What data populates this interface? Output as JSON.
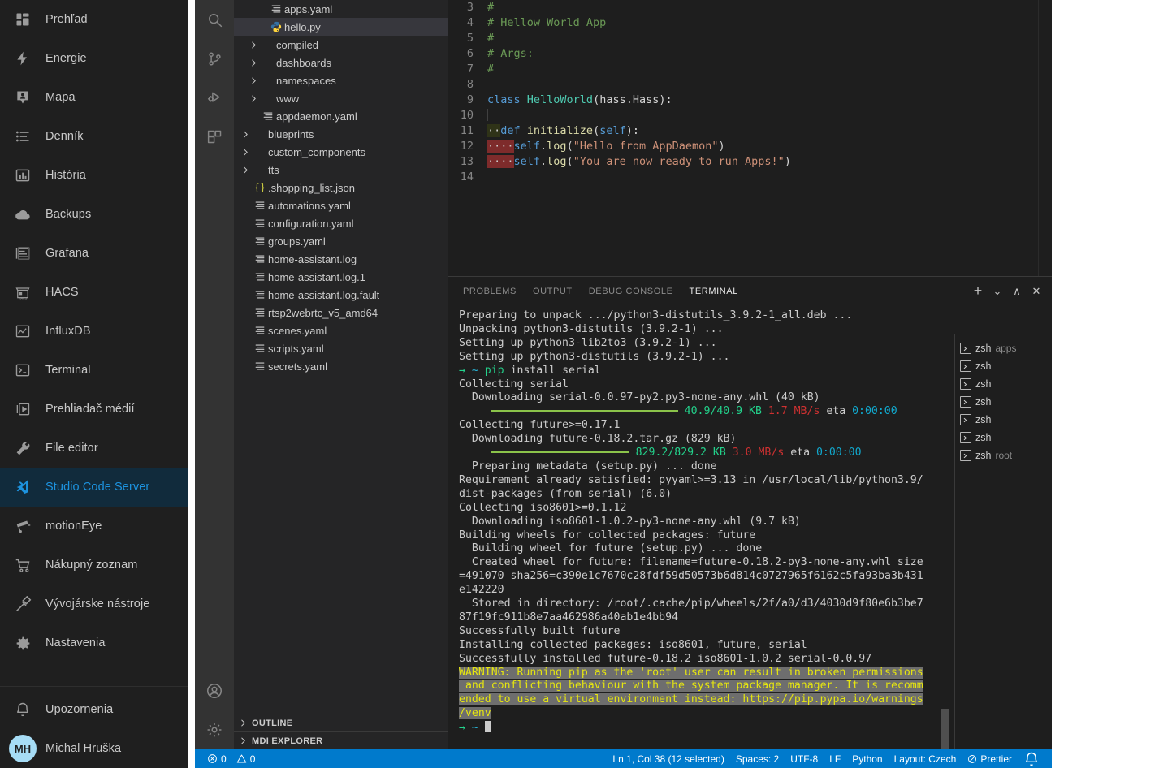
{
  "ha_sidebar": {
    "items": [
      {
        "label": "Prehľad",
        "icon": "dashboard-icon",
        "active": false
      },
      {
        "label": "Energie",
        "icon": "lightning-icon",
        "active": false
      },
      {
        "label": "Mapa",
        "icon": "map-marker-icon",
        "active": false
      },
      {
        "label": "Denník",
        "icon": "logbook-icon",
        "active": false
      },
      {
        "label": "História",
        "icon": "chart-bar-icon",
        "active": false
      },
      {
        "label": "Backups",
        "icon": "cloud-icon",
        "active": false
      },
      {
        "label": "Grafana",
        "icon": "grafana-icon",
        "active": false
      },
      {
        "label": "HACS",
        "icon": "hacs-store-icon",
        "active": false
      },
      {
        "label": "InfluxDB",
        "icon": "influxdb-chart-icon",
        "active": false
      },
      {
        "label": "Terminal",
        "icon": "terminal-icon",
        "active": false
      },
      {
        "label": "Prehliadač médií",
        "icon": "media-player-icon",
        "active": false
      },
      {
        "label": "File editor",
        "icon": "wrench-icon",
        "active": false
      },
      {
        "label": "Studio Code Server",
        "icon": "vscode-icon",
        "active": true
      },
      {
        "label": "motionEye",
        "icon": "cctv-camera-icon",
        "active": false
      },
      {
        "label": "Nákupný zoznam",
        "icon": "shopping-cart-icon",
        "active": false
      },
      {
        "label": "Vývojárske nástroje",
        "icon": "hammer-icon",
        "active": false
      },
      {
        "label": "Nastavenia",
        "icon": "gear-icon",
        "active": false
      }
    ],
    "footer": [
      {
        "label": "Upozornenia",
        "icon": "bell-icon"
      },
      {
        "label": "Michal Hruška",
        "icon": "avatar",
        "initials": "MH"
      }
    ],
    "accent_color": "#1d93df",
    "active_bg": "#112b3c"
  },
  "activity_bar": {
    "icons": [
      {
        "name": "search-icon"
      },
      {
        "name": "source-control-icon"
      },
      {
        "name": "run-and-debug-icon"
      },
      {
        "name": "extensions-icon"
      }
    ],
    "bottom_icons": [
      {
        "name": "accounts-icon"
      },
      {
        "name": "manage-gear-icon"
      }
    ]
  },
  "explorer": {
    "rows": [
      {
        "indent": 3,
        "twist": "",
        "icon": "yaml-icon",
        "name": "apps.yaml",
        "selected": false
      },
      {
        "indent": 3,
        "twist": "",
        "icon": "python-icon",
        "name": "hello.py",
        "selected": true
      },
      {
        "indent": 2,
        "twist": "chevron-right-icon",
        "icon": "",
        "name": "compiled",
        "selected": false
      },
      {
        "indent": 2,
        "twist": "chevron-right-icon",
        "icon": "",
        "name": "dashboards",
        "selected": false
      },
      {
        "indent": 2,
        "twist": "chevron-right-icon",
        "icon": "",
        "name": "namespaces",
        "selected": false
      },
      {
        "indent": 2,
        "twist": "chevron-right-icon",
        "icon": "",
        "name": "www",
        "selected": false
      },
      {
        "indent": 2,
        "twist": "",
        "icon": "yaml-icon",
        "name": "appdaemon.yaml",
        "selected": false
      },
      {
        "indent": 1,
        "twist": "chevron-right-icon",
        "icon": "",
        "name": "blueprints",
        "selected": false
      },
      {
        "indent": 1,
        "twist": "chevron-right-icon",
        "icon": "",
        "name": "custom_components",
        "selected": false
      },
      {
        "indent": 1,
        "twist": "chevron-right-icon",
        "icon": "",
        "name": "tts",
        "selected": false
      },
      {
        "indent": 1,
        "twist": "",
        "icon": "json-icon",
        "name": ".shopping_list.json",
        "selected": false
      },
      {
        "indent": 1,
        "twist": "",
        "icon": "yaml-icon",
        "name": "automations.yaml",
        "selected": false
      },
      {
        "indent": 1,
        "twist": "",
        "icon": "yaml-icon",
        "name": "configuration.yaml",
        "selected": false
      },
      {
        "indent": 1,
        "twist": "",
        "icon": "yaml-icon",
        "name": "groups.yaml",
        "selected": false
      },
      {
        "indent": 1,
        "twist": "",
        "icon": "yaml-icon",
        "name": "home-assistant.log",
        "selected": false
      },
      {
        "indent": 1,
        "twist": "",
        "icon": "yaml-icon",
        "name": "home-assistant.log.1",
        "selected": false
      },
      {
        "indent": 1,
        "twist": "",
        "icon": "yaml-icon",
        "name": "home-assistant.log.fault",
        "selected": false
      },
      {
        "indent": 1,
        "twist": "",
        "icon": "yaml-icon",
        "name": "rtsp2webrtc_v5_amd64",
        "selected": false
      },
      {
        "indent": 1,
        "twist": "",
        "icon": "yaml-icon",
        "name": "scenes.yaml",
        "selected": false
      },
      {
        "indent": 1,
        "twist": "",
        "icon": "yaml-icon",
        "name": "scripts.yaml",
        "selected": false
      },
      {
        "indent": 1,
        "twist": "",
        "icon": "yaml-icon",
        "name": "secrets.yaml",
        "selected": false
      }
    ],
    "sections": [
      {
        "label": "OUTLINE"
      },
      {
        "label": "MDI EXPLORER"
      }
    ]
  },
  "editor": {
    "lines": [
      {
        "num": "3",
        "segments": [
          {
            "t": "#",
            "c": "c-comment",
            "pad": 0
          }
        ]
      },
      {
        "num": "4",
        "segments": [
          {
            "t": "# Hellow World App",
            "c": "c-comment",
            "pad": 0
          }
        ]
      },
      {
        "num": "5",
        "segments": [
          {
            "t": "#",
            "c": "c-comment",
            "pad": 0
          }
        ]
      },
      {
        "num": "6",
        "segments": [
          {
            "t": "# Args:",
            "c": "c-comment",
            "pad": 0
          }
        ]
      },
      {
        "num": "7",
        "segments": [
          {
            "t": "#",
            "c": "c-comment",
            "pad": 0
          }
        ]
      },
      {
        "num": "8",
        "segments": []
      },
      {
        "num": "9",
        "segments": [
          {
            "t": "class ",
            "c": "c-key"
          },
          {
            "t": "HelloWorld",
            "c": "c-class"
          },
          {
            "t": "(hass.Hass):",
            "c": "c-plain"
          }
        ]
      },
      {
        "num": "10",
        "segments": []
      },
      {
        "num": "11",
        "segments": [
          {
            "t": "··",
            "c": "ws-ok"
          },
          {
            "t": "def ",
            "c": "c-key"
          },
          {
            "t": "initialize",
            "c": "c-fn"
          },
          {
            "t": "(",
            "c": "c-plain"
          },
          {
            "t": "self",
            "c": "c-key"
          },
          {
            "t": "):",
            "c": "c-plain"
          }
        ]
      },
      {
        "num": "12",
        "segments": [
          {
            "t": "····",
            "c": "ws-err"
          },
          {
            "t": "self",
            "c": "c-key"
          },
          {
            "t": ".",
            "c": "c-plain"
          },
          {
            "t": "log",
            "c": "c-fn"
          },
          {
            "t": "(",
            "c": "c-plain"
          },
          {
            "t": "\"Hello from AppDaemon\"",
            "c": "c-str"
          },
          {
            "t": ")",
            "c": "c-plain"
          }
        ]
      },
      {
        "num": "13",
        "segments": [
          {
            "t": "····",
            "c": "ws-err"
          },
          {
            "t": "self",
            "c": "c-key"
          },
          {
            "t": ".",
            "c": "c-plain"
          },
          {
            "t": "log",
            "c": "c-fn"
          },
          {
            "t": "(",
            "c": "c-plain"
          },
          {
            "t": "\"You are now ready to run Apps!\"",
            "c": "c-str"
          },
          {
            "t": ")",
            "c": "c-plain"
          }
        ]
      },
      {
        "num": "14",
        "segments": []
      }
    ]
  },
  "panel": {
    "tabs": [
      {
        "label": "PROBLEMS",
        "active": false
      },
      {
        "label": "OUTPUT",
        "active": false
      },
      {
        "label": "DEBUG CONSOLE",
        "active": false
      },
      {
        "label": "TERMINAL",
        "active": true
      }
    ],
    "actions": [
      {
        "name": "new-terminal-icon",
        "glyph": "+"
      },
      {
        "name": "terminal-dropdown-icon",
        "glyph": "⌄"
      },
      {
        "name": "maximize-panel-icon",
        "glyph": "∧"
      },
      {
        "name": "close-panel-icon",
        "glyph": "✕"
      }
    ],
    "terminal_list": [
      {
        "label": "zsh",
        "sub": "apps"
      },
      {
        "label": "zsh",
        "sub": ""
      },
      {
        "label": "zsh",
        "sub": ""
      },
      {
        "label": "zsh",
        "sub": ""
      },
      {
        "label": "zsh",
        "sub": ""
      },
      {
        "label": "zsh",
        "sub": ""
      },
      {
        "label": "zsh",
        "sub": "root"
      }
    ],
    "terminal_lines": [
      [
        {
          "t": "Preparing to unpack .../python3-distutils_3.9.2-1_all.deb ..."
        }
      ],
      [
        {
          "t": "Unpacking python3-distutils (3.9.2-1) ..."
        }
      ],
      [
        {
          "t": "Setting up python3-lib2to3 (3.9.2-1) ..."
        }
      ],
      [
        {
          "t": "Setting up python3-distutils (3.9.2-1) ..."
        }
      ],
      [
        {
          "t": "→ ",
          "c": "t-arrow"
        },
        {
          "t": "~ ",
          "c": "t-tilde"
        },
        {
          "t": "pip",
          "c": "t-green"
        },
        {
          "t": " install serial"
        }
      ],
      [
        {
          "t": "Collecting serial"
        }
      ],
      [
        {
          "t": "  Downloading serial-0.0.97-py2.py3-none-any.whl (40 kB)"
        }
      ],
      [
        {
          "t": "     ",
          "bar": 1
        },
        {
          "t": " 40.9/40.9 KB",
          "c": "t-green"
        },
        {
          "t": " 1.7 MB/s",
          "c": "t-red"
        },
        {
          "t": " eta "
        },
        {
          "t": "0:00:00",
          "c": "t-blue"
        }
      ],
      [
        {
          "t": "Collecting future>=0.17.1"
        }
      ],
      [
        {
          "t": "  Downloading future-0.18.2.tar.gz (829 kB)"
        }
      ],
      [
        {
          "t": "     ",
          "bar": 2
        },
        {
          "t": " 829.2/829.2 KB",
          "c": "t-green"
        },
        {
          "t": " 3.0 MB/s",
          "c": "t-red"
        },
        {
          "t": " eta "
        },
        {
          "t": "0:00:00",
          "c": "t-blue"
        }
      ],
      [
        {
          "t": "  Preparing metadata (setup.py) ... done"
        }
      ],
      [
        {
          "t": "Requirement already satisfied: pyyaml>=3.13 in /usr/local/lib/python3.9/"
        }
      ],
      [
        {
          "t": "dist-packages (from serial) (6.0)"
        }
      ],
      [
        {
          "t": "Collecting iso8601>=0.1.12"
        }
      ],
      [
        {
          "t": "  Downloading iso8601-1.0.2-py3-none-any.whl (9.7 kB)"
        }
      ],
      [
        {
          "t": "Building wheels for collected packages: future"
        }
      ],
      [
        {
          "t": "  Building wheel for future (setup.py) ... done"
        }
      ],
      [
        {
          "t": "  Created wheel for future: filename=future-0.18.2-py3-none-any.whl size"
        }
      ],
      [
        {
          "t": "=491070 sha256=c390e1c7670c28fdf59d50573b6d814c0727965f6162c5fa93ba3b431"
        }
      ],
      [
        {
          "t": "e142220"
        }
      ],
      [
        {
          "t": "  Stored in directory: /root/.cache/pip/wheels/2f/a0/d3/4030d9f80e6b3be7"
        }
      ],
      [
        {
          "t": "87f19fc911b8e7aa462986a40ab1e4bb94"
        }
      ],
      [
        {
          "t": "Successfully built future"
        }
      ],
      [
        {
          "t": "Installing collected packages: iso8601, future, serial"
        }
      ],
      [
        {
          "t": "Successfully installed future-0.18.2 iso8601-1.0.2 serial-0.0.97"
        }
      ],
      [
        {
          "t": "WARNING: Running pip as the 'root' user can result in broken permissions",
          "c": "t-sel"
        }
      ],
      [
        {
          "t": " and conflicting behaviour with the system package manager. It is recomm",
          "c": "t-sel"
        }
      ],
      [
        {
          "t": "ended to use a virtual environment instead: https://pip.pypa.io/warnings",
          "c": "t-sel"
        }
      ],
      [
        {
          "t": "/venv",
          "c": "t-sel"
        }
      ],
      [
        {
          "t": "→ ",
          "c": "t-arrow"
        },
        {
          "t": "~ ",
          "c": "t-tilde"
        },
        {
          "t": "",
          "cursor": true
        }
      ]
    ]
  },
  "statusbar": {
    "left": [
      {
        "name": "errors-warnings",
        "icon": "error-circle-icon",
        "text": "0",
        "icon2": "warning-triangle-icon",
        "text2": "0"
      }
    ],
    "right": [
      {
        "name": "cursor-position",
        "label": "Ln 1, Col 38 (12 selected)"
      },
      {
        "name": "indentation",
        "label": "Spaces: 2"
      },
      {
        "name": "encoding",
        "label": "UTF-8"
      },
      {
        "name": "eol",
        "label": "LF"
      },
      {
        "name": "language-mode",
        "label": "Python"
      },
      {
        "name": "keyboard-layout",
        "label": "Layout: Czech"
      },
      {
        "name": "prettier",
        "label": "Prettier",
        "icon": "prettier-block-icon"
      },
      {
        "name": "notifications",
        "label": "",
        "icon": "bell-icon"
      }
    ]
  }
}
